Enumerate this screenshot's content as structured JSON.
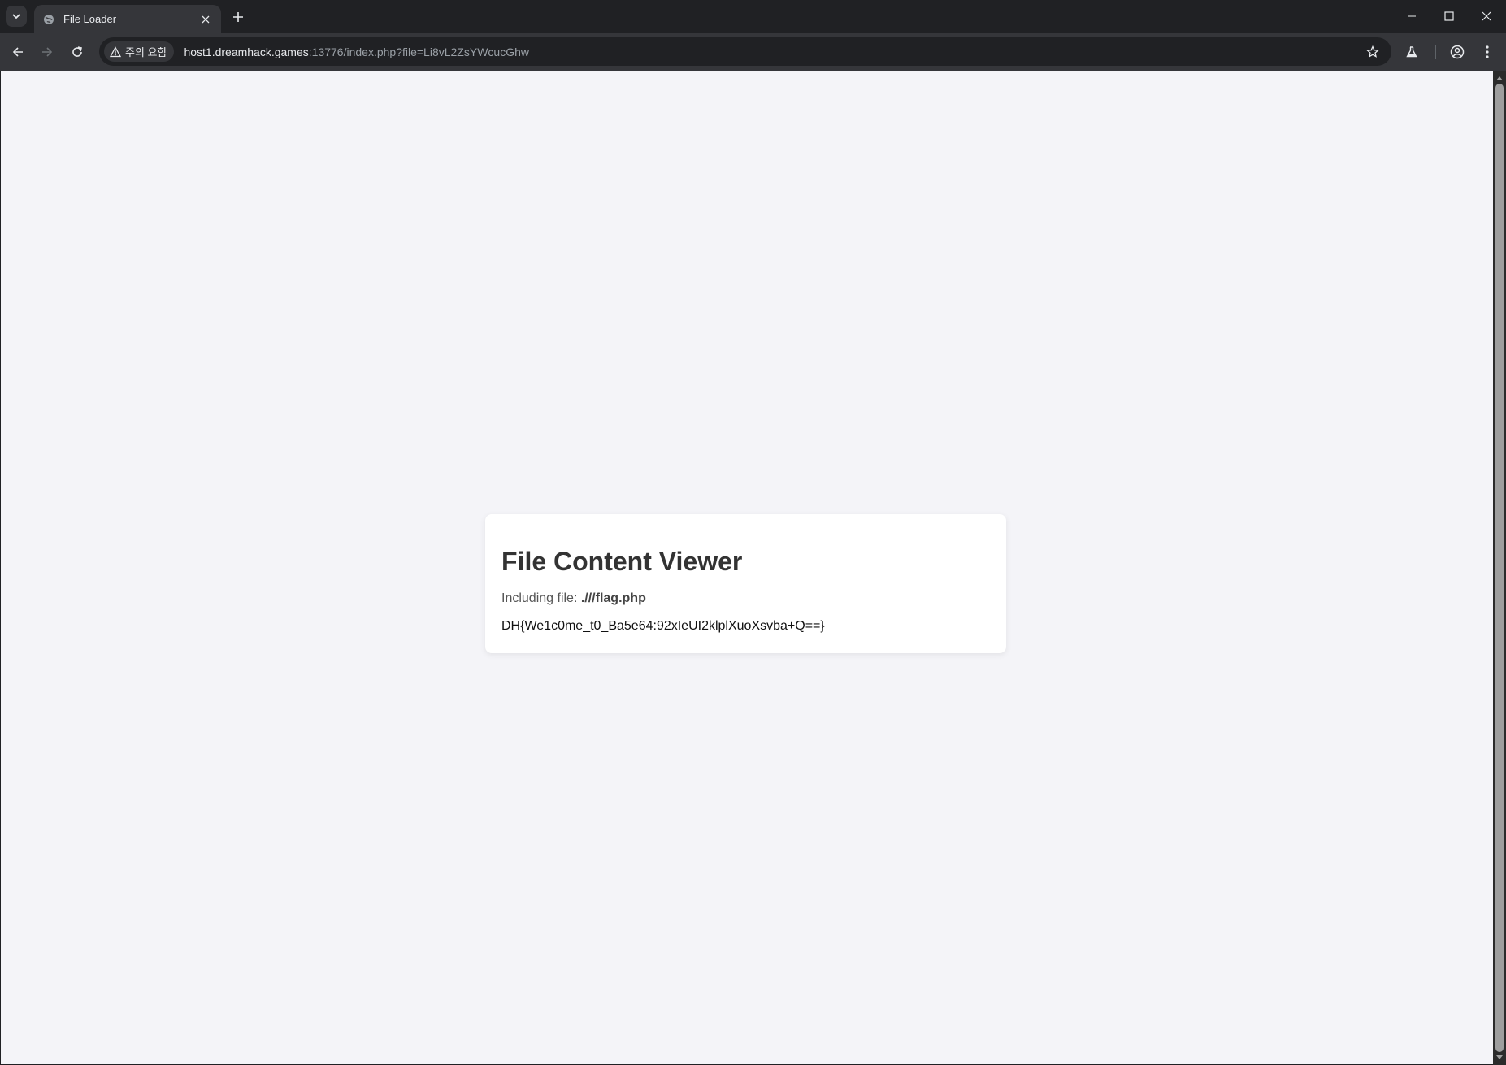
{
  "browser": {
    "tab_title": "File Loader",
    "security_chip": "주의 요함",
    "url_host": "host1.dreamhack.games",
    "url_rest": ":13776/index.php?file=Li8vL2ZsYWcucGhw"
  },
  "page": {
    "heading": "File Content Viewer",
    "including_label": "Including file: ",
    "including_file": ".///flag.php",
    "file_content": "DH{We1c0me_t0_Ba5e64:92xIeUI2klplXuoXsvba+Q==}"
  }
}
